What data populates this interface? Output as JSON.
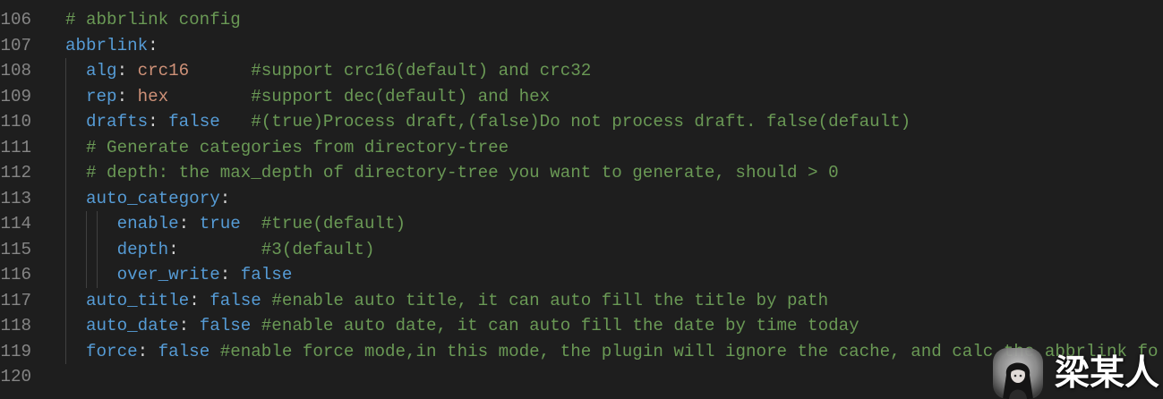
{
  "editor": {
    "colors": {
      "background": "#1e1e1e",
      "line_number": "#858585",
      "comment": "#6a9955",
      "key": "#569cd6",
      "string": "#ce9178",
      "boolean": "#569cd6",
      "punctuation": "#d4d4d4",
      "indent_guide": "#404040"
    },
    "lines": [
      {
        "number": "106",
        "comment": "# abbrlink config"
      },
      {
        "number": "107",
        "key": "abbrlink",
        "colon": ":"
      },
      {
        "number": "108",
        "indent": "  ",
        "key": "alg",
        "colon": ": ",
        "value": "crc16",
        "gap": "      ",
        "comment": "#support crc16(default) and crc32"
      },
      {
        "number": "109",
        "indent": "  ",
        "key": "rep",
        "colon": ": ",
        "value": "hex",
        "gap": "        ",
        "comment": "#support dec(default) and hex"
      },
      {
        "number": "110",
        "indent": "  ",
        "key": "drafts",
        "colon": ": ",
        "value": "false",
        "gap": "   ",
        "comment": "#(true)Process draft,(false)Do not process draft. false(default)"
      },
      {
        "number": "111",
        "indent": "  ",
        "comment": "# Generate categories from directory-tree"
      },
      {
        "number": "112",
        "indent": "  ",
        "comment": "# depth: the max_depth of directory-tree you want to generate, should > 0"
      },
      {
        "number": "113",
        "indent": "  ",
        "key": "auto_category",
        "colon": ":"
      },
      {
        "number": "114",
        "indent": "     ",
        "key": "enable",
        "colon": ": ",
        "value": "true",
        "gap": "  ",
        "comment": "#true(default)"
      },
      {
        "number": "115",
        "indent": "     ",
        "key": "depth",
        "colon": ":",
        "gap": "        ",
        "comment": "#3(default)"
      },
      {
        "number": "116",
        "indent": "     ",
        "key": "over_write",
        "colon": ": ",
        "value": "false"
      },
      {
        "number": "117",
        "indent": "  ",
        "key": "auto_title",
        "colon": ": ",
        "value": "false",
        "gap": " ",
        "comment": "#enable auto title, it can auto fill the title by path"
      },
      {
        "number": "118",
        "indent": "  ",
        "key": "auto_date",
        "colon": ": ",
        "value": "false",
        "gap": " ",
        "comment": "#enable auto date, it can auto fill the date by time today"
      },
      {
        "number": "119",
        "indent": "  ",
        "key": "force",
        "colon": ": ",
        "value": "false",
        "gap": " ",
        "comment": "#enable force mode,in this mode, the plugin will ignore the cache, and calc the abbrlink fo"
      },
      {
        "number": "120"
      }
    ]
  },
  "watermark": {
    "avatar": "avatar-icon",
    "text": "梁某人",
    "text_color": "#ffffff"
  }
}
